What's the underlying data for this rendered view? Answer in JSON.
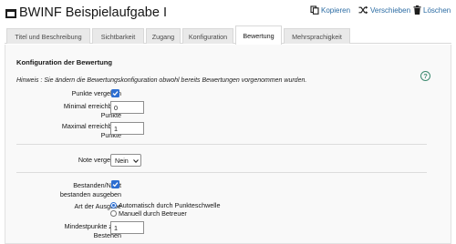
{
  "header": {
    "title": "BWINF Beispielaufgabe I",
    "actions": {
      "copy_label": "Kopieren",
      "move_label": "Verschieben",
      "delete_label": "Löschen"
    }
  },
  "tabs": [
    {
      "label": "Titel und Beschreibung"
    },
    {
      "label": "Sichtbarkeit"
    },
    {
      "label": "Zugang"
    },
    {
      "label": "Konfiguration"
    },
    {
      "label": "Bewertung",
      "active": true
    },
    {
      "label": "Mehrsprachigkeit"
    }
  ],
  "section": {
    "title": "Konfiguration der Bewertung",
    "hint": "Hinweis : Sie ändern die Bewertungskonfiguration obwohl bereits Bewertungen vorgenommen wurden.",
    "help_glyph": "?"
  },
  "form": {
    "punkte_vergeben": {
      "label": "Punkte vergeben",
      "checked": true
    },
    "min_punkte": {
      "label_line1": "Minimal erreichbare",
      "label_line2": "Punkte",
      "value": "0"
    },
    "max_punkte": {
      "label_line1": "Maximal erreichbare",
      "label_line2": "Punkte",
      "value": "1"
    },
    "note_vergeben": {
      "label": "Note vergeben",
      "value": "Nein"
    },
    "bestanden": {
      "label_line1": "Bestanden/Nicht",
      "label_line2": "bestanden ausgeben",
      "checked": true
    },
    "art_ausgabe": {
      "label": "Art der Ausgabe",
      "options": [
        {
          "label": "Automatisch durch Punkteschwelle",
          "selected": true
        },
        {
          "label": "Manuell durch Betreuer",
          "selected": false
        }
      ]
    },
    "mindestpunkte": {
      "label_line1": "Mindestpunkte zum",
      "label_line2": "Bestehen",
      "value": "1"
    }
  },
  "colors": {
    "accent": "#2e6fd1",
    "link": "#2a6ba3",
    "help": "#3d8a70"
  }
}
